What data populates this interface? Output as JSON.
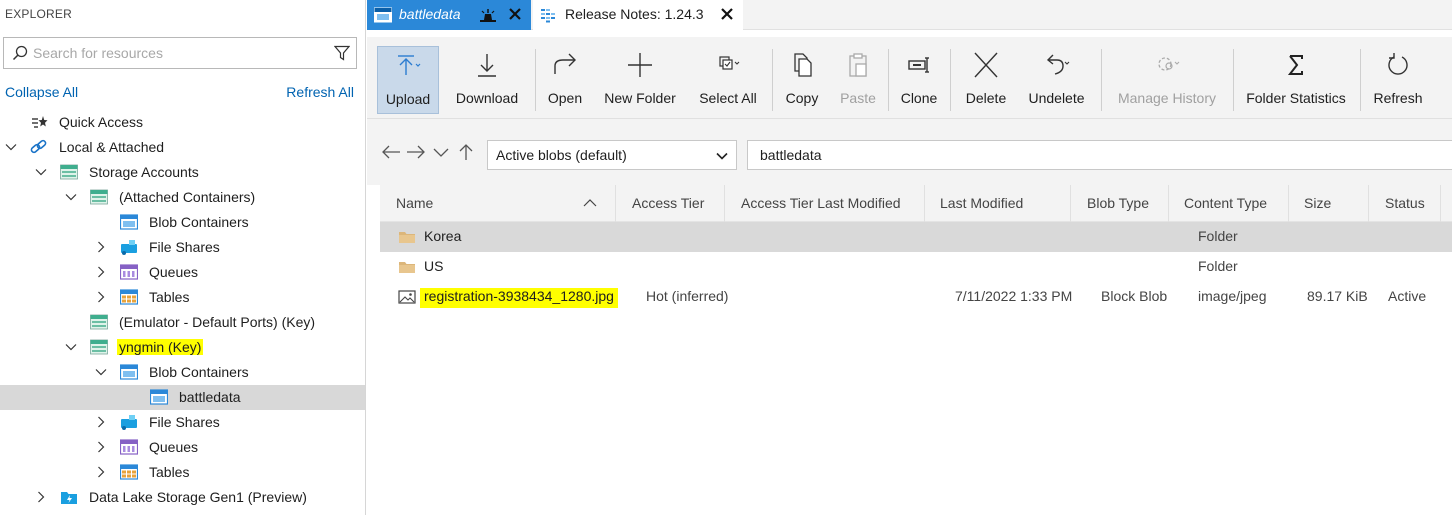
{
  "explorer": {
    "title": "EXPLORER",
    "search_placeholder": "Search for resources",
    "collapse_all": "Collapse All",
    "refresh_all": "Refresh All",
    "tree": [
      {
        "label": "Quick Access",
        "icon": "quick-access-icon"
      },
      {
        "label": "Local & Attached",
        "icon": "link-icon"
      },
      {
        "label": "Storage Accounts",
        "icon": "storage-account-icon"
      },
      {
        "label": "(Attached Containers)",
        "icon": "storage-account-icon"
      },
      {
        "label": "Blob Containers",
        "icon": "blob-container-icon"
      },
      {
        "label": "File Shares",
        "icon": "file-share-icon"
      },
      {
        "label": "Queues",
        "icon": "queue-icon"
      },
      {
        "label": "Tables",
        "icon": "table-icon"
      },
      {
        "label": "(Emulator - Default Ports) (Key)",
        "icon": "storage-account-icon"
      },
      {
        "label": "yngmin (Key)",
        "icon": "storage-account-icon"
      },
      {
        "label": "Blob Containers",
        "icon": "blob-container-icon"
      },
      {
        "label": "battledata",
        "icon": "blob-container-icon"
      },
      {
        "label": "File Shares",
        "icon": "file-share-icon"
      },
      {
        "label": "Queues",
        "icon": "queue-icon"
      },
      {
        "label": "Tables",
        "icon": "table-icon"
      },
      {
        "label": "Data Lake Storage Gen1 (Preview)",
        "icon": "data-lake-icon"
      }
    ]
  },
  "tabs": [
    {
      "label": "battledata",
      "icon": "blob-container-icon",
      "active": true
    },
    {
      "label": "Release Notes: 1.24.3",
      "icon": "release-notes-icon",
      "active": false
    }
  ],
  "toolbar": {
    "upload": "Upload",
    "download": "Download",
    "open": "Open",
    "new_folder": "New Folder",
    "select_all": "Select All",
    "copy": "Copy",
    "paste": "Paste",
    "clone": "Clone",
    "delete": "Delete",
    "undelete": "Undelete",
    "manage_history": "Manage History",
    "folder_statistics": "Folder Statistics",
    "refresh": "Refresh"
  },
  "nav": {
    "view_selected": "Active blobs (default)",
    "path": "battledata"
  },
  "grid": {
    "columns": [
      "Name",
      "Access Tier",
      "Access Tier Last Modified",
      "Last Modified",
      "Blob Type",
      "Content Type",
      "Size",
      "Status"
    ],
    "rows": [
      {
        "name": "Korea",
        "icon": "folder-icon",
        "access_tier": "",
        "tier_modified": "",
        "last_modified": "",
        "blob_type": "",
        "content_type": "Folder",
        "size": "",
        "status": ""
      },
      {
        "name": "US",
        "icon": "folder-icon",
        "access_tier": "",
        "tier_modified": "",
        "last_modified": "",
        "blob_type": "",
        "content_type": "Folder",
        "size": "",
        "status": ""
      },
      {
        "name": "registration-3938434_1280.jpg",
        "icon": "image-file-icon",
        "access_tier": "Hot (inferred)",
        "tier_modified": "",
        "last_modified": "7/11/2022 1:33 PM",
        "blob_type": "Block Blob",
        "content_type": "image/jpeg",
        "size": "89.17 KiB",
        "status": "Active"
      }
    ]
  },
  "colors": {
    "highlight": "#ffff00",
    "accent": "#2b88d8",
    "link": "#0063b1",
    "selection": "#d9d9d9"
  }
}
